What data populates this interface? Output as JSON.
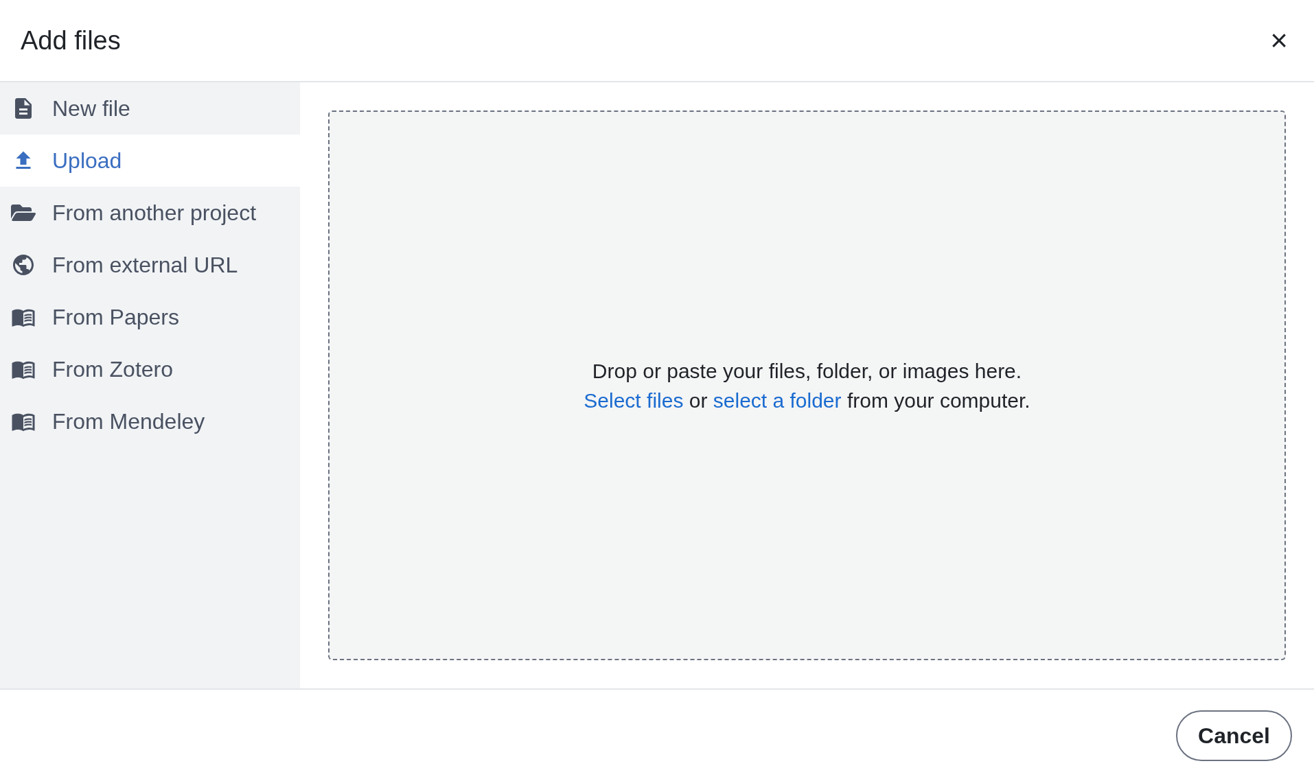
{
  "dialog": {
    "title": "Add files",
    "close": "×"
  },
  "sidebar": {
    "items": [
      {
        "label": "New file",
        "selected": false
      },
      {
        "label": "Upload",
        "selected": true
      },
      {
        "label": "From another project",
        "selected": false
      },
      {
        "label": "From external URL",
        "selected": false
      },
      {
        "label": "From Papers",
        "selected": false
      },
      {
        "label": "From Zotero",
        "selected": false
      },
      {
        "label": "From Mendeley",
        "selected": false
      }
    ]
  },
  "dropzone": {
    "text_start": "Drop or paste your files, folder, or images here.",
    "link_files": "Select files",
    "text_middle": "or",
    "link_folder": "select a folder",
    "text_end": "from your computer."
  },
  "footer": {
    "buttons": [
      "Cancel"
    ]
  }
}
